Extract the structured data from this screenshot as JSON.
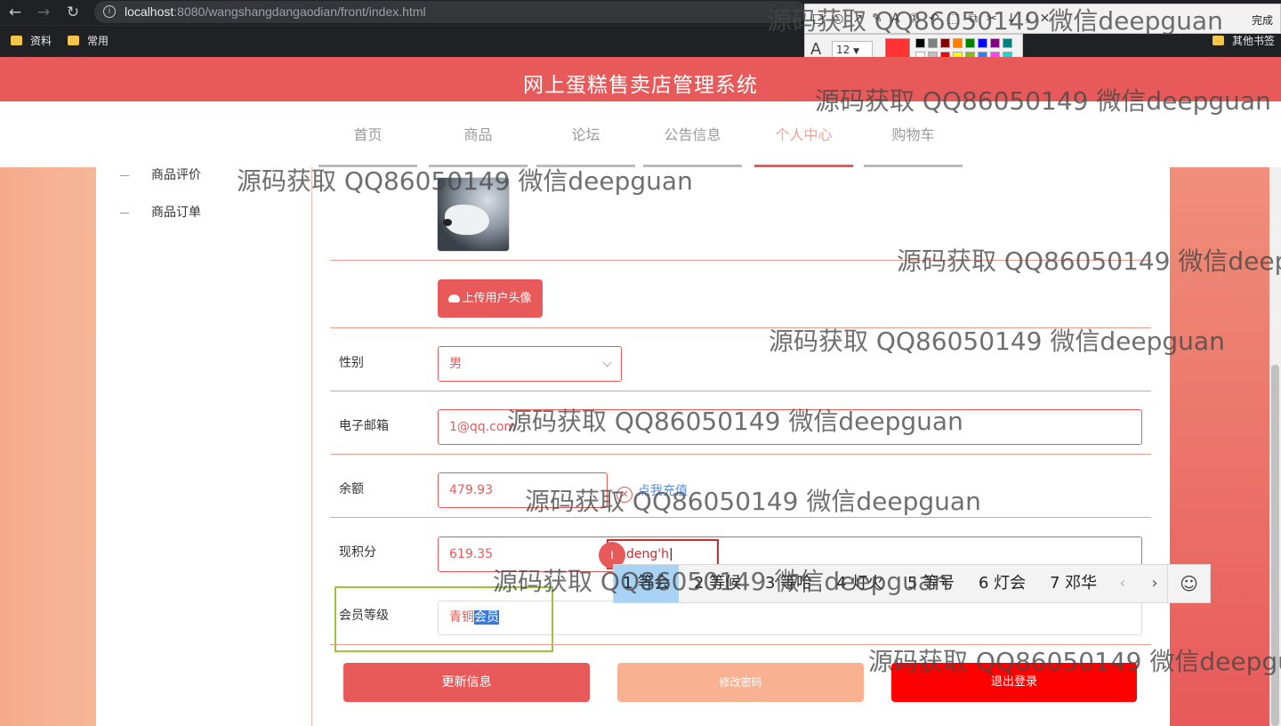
{
  "browser": {
    "url_host": "localhost",
    "url_path": ":8080/wangshangdangaodian/front/index.html",
    "bookmarks": [
      "资料",
      "常用"
    ],
    "bookmarks_right": "其他书签"
  },
  "snip_tool": {
    "font_size": "12",
    "done_label": "完成",
    "current_color": "#ff3333",
    "palette": [
      "#000000",
      "#808080",
      "#800000",
      "#ff8000",
      "#008000",
      "#0000ff",
      "#800080",
      "#008080",
      "#ffffff",
      "#c0c0c0",
      "#ff0000",
      "#ffff00",
      "#80c000",
      "#3080ff",
      "#ff40ff",
      "#00e0e0"
    ]
  },
  "header": {
    "title": "网上蛋糕售卖店管理系统"
  },
  "nav": {
    "items": [
      "首页",
      "商品",
      "论坛",
      "公告信息",
      "个人中心",
      "购物车"
    ],
    "active": "个人中心"
  },
  "sidebar": {
    "items": [
      "商品评价",
      "商品订单"
    ]
  },
  "form": {
    "upload_label": "上传用户头像",
    "gender_label": "性别",
    "gender_value": "男",
    "email_label": "电子邮箱",
    "email_value": "1@qq.com",
    "balance_label": "余额",
    "balance_value": "479.93",
    "recharge_label": "点我充值",
    "points_label": "现积分",
    "points_value": "619.35",
    "level_label": "会员等级",
    "level_value_plain": "青铜",
    "level_value_selected": "会员"
  },
  "buttons": {
    "update": "更新信息",
    "change_password": "修改密码",
    "logout": "退出登录"
  },
  "ime": {
    "composition": "deng'h",
    "candidates": [
      "1 等会",
      "2 等候",
      "3 等哈",
      "4 灯火",
      "5 等号",
      "6 灯会",
      "7 邓华"
    ]
  },
  "watermark": "源码获取 QQ86050149 微信deepguan",
  "colors": {
    "brand_red": "#e85a5a",
    "peach": "#f8b292",
    "logout_red": "#ff0000",
    "highlight_green": "#9ac43a"
  }
}
